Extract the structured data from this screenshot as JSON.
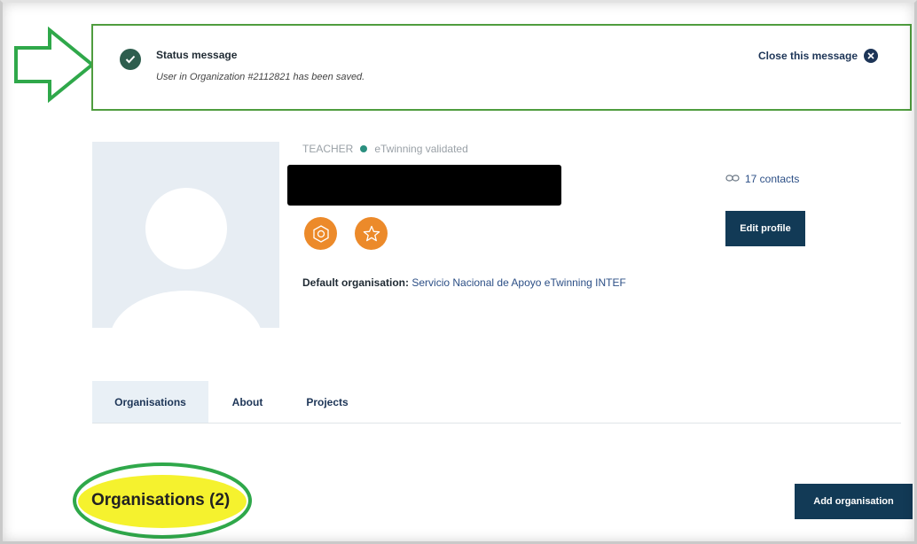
{
  "status": {
    "title": "Status message",
    "message": "User in Organization #2112821 has been saved.",
    "close_label": "Close this message"
  },
  "profile": {
    "role": "TEACHER",
    "validation": "eTwinning validated",
    "contacts": "17 contacts",
    "edit_button": "Edit profile",
    "default_org_label": "Default organisation:",
    "default_org_value": "Servicio Nacional de Apoyo eTwinning INTEF",
    "badges": [
      "badge-hexagon-icon",
      "badge-star-icon"
    ]
  },
  "tabs": [
    {
      "label": "Organisations",
      "active": true
    },
    {
      "label": "About",
      "active": false
    },
    {
      "label": "Projects",
      "active": false
    }
  ],
  "section": {
    "title": "Organisations (2)",
    "add_button": "Add organisation"
  },
  "colors": {
    "accent_dark": "#123a56",
    "badge_orange": "#ec8a2a",
    "annotation_green": "#2fa84a",
    "annotation_yellow": "#f4f11c"
  }
}
